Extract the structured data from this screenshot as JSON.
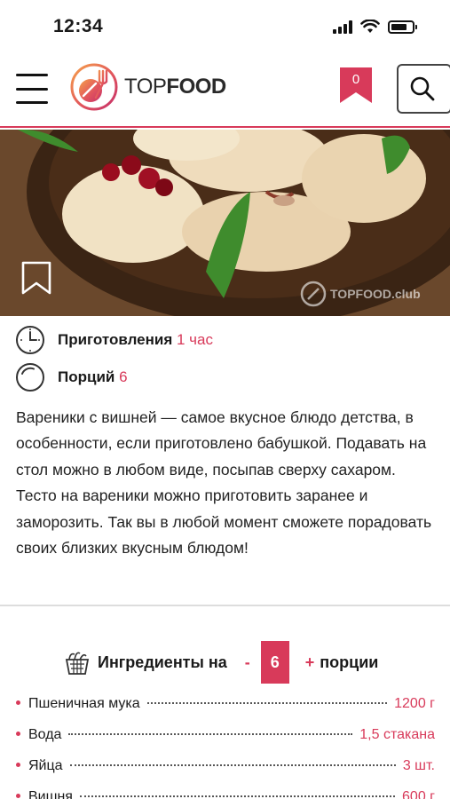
{
  "status": {
    "time": "12:34"
  },
  "header": {
    "logo_light": "TOP",
    "logo_bold": "FOOD",
    "bookmark_count": "0"
  },
  "hero": {
    "watermark": "TOPFOOD.club"
  },
  "meta": {
    "prep_label": "Приготовления",
    "prep_value": "1 час",
    "servings_label": "Порций",
    "servings_value": "6"
  },
  "description": [
    "Вареники с вишней — самое вкусное блюдо детства, в особенности, если приготовлено бабушкой. Подавать на стол можно в любом виде, посыпав сверху сахаром.",
    "Тесто на вареники можно приготовить заранее и заморозить. Так вы в любой момент сможете порадовать своих близких вкусным блюдом!"
  ],
  "ingredients": {
    "title": "Ингредиенты на",
    "minus": "-",
    "count": "6",
    "plus": "+",
    "suffix": "порции",
    "items": [
      {
        "name": "Пшеничная мука",
        "qty": "1200 г"
      },
      {
        "name": "Вода",
        "qty": "1,5 стакана"
      },
      {
        "name": "Яйца",
        "qty": "3 шт."
      },
      {
        "name": "Вишня",
        "qty": "600 г"
      }
    ]
  },
  "colors": {
    "accent": "#d83a5a"
  }
}
